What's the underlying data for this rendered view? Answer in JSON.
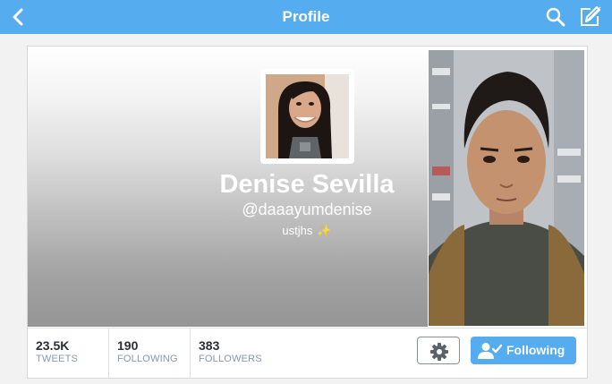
{
  "topbar": {
    "title": "Profile",
    "back_icon": "chevron-left-icon",
    "search_icon": "search-icon",
    "compose_icon": "compose-icon",
    "background_color": "#55acee"
  },
  "profile": {
    "display_name": "Denise Sevilla",
    "handle": "@daaayumdenise",
    "bio": "ustjhs",
    "bio_emoji": "✨"
  },
  "stats": [
    {
      "value": "23.5K",
      "label": "TWEETS"
    },
    {
      "value": "190",
      "label": "FOLLOWING"
    },
    {
      "value": "383",
      "label": "FOLLOWERS"
    }
  ],
  "actions": {
    "settings_icon": "gear-icon",
    "follow_label": "Following",
    "follow_icon": "person-check-icon",
    "accent_color": "#55acee"
  }
}
